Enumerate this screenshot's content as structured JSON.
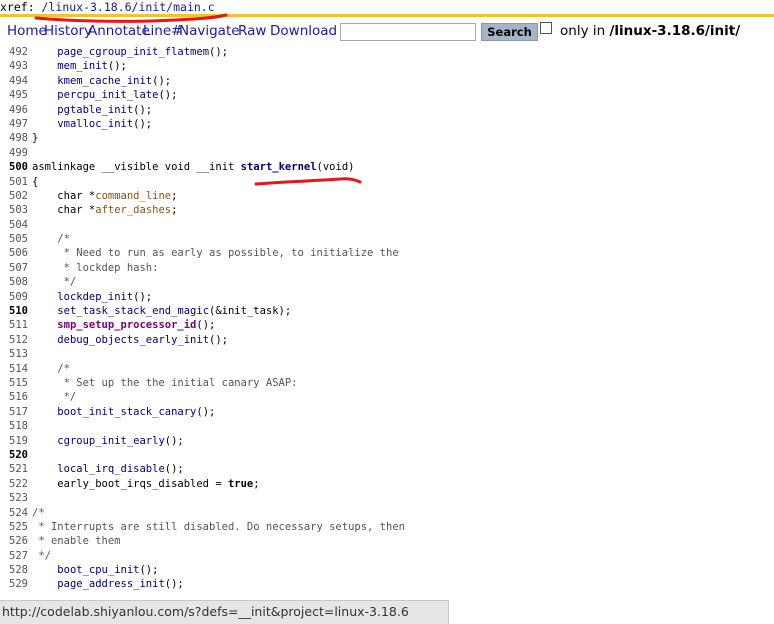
{
  "xref": {
    "prefix": "xref: ",
    "path": "/linux-3.18.6/init/main.c"
  },
  "nav": {
    "links": [
      "Home",
      "History",
      "Annotate",
      "Line#",
      "Navigate",
      "Raw",
      "Download"
    ],
    "search_button": "Search",
    "only_in_prefix": "only in ",
    "only_in_path": "/linux-3.18.6/init/"
  },
  "code_lines": [
    {
      "num": "492",
      "text": "    page_cgroup_init_flatmem();"
    },
    {
      "num": "493",
      "text": "    mem_init();"
    },
    {
      "num": "494",
      "text": "    kmem_cache_init();"
    },
    {
      "num": "495",
      "text": "    percpu_init_late();"
    },
    {
      "num": "496",
      "text": "    pgtable_init();"
    },
    {
      "num": "497",
      "text": "    vmalloc_init();"
    },
    {
      "num": "498",
      "text": "}"
    },
    {
      "num": "499",
      "text": ""
    },
    {
      "num": "500",
      "text": "asmlinkage __visible void __init start_kernel(void)"
    },
    {
      "num": "501",
      "text": "{"
    },
    {
      "num": "502",
      "text": "    char *command_line;"
    },
    {
      "num": "503",
      "text": "    char *after_dashes;"
    },
    {
      "num": "504",
      "text": ""
    },
    {
      "num": "505",
      "text": "    /*"
    },
    {
      "num": "506",
      "text": "     * Need to run as early as possible, to initialize the"
    },
    {
      "num": "507",
      "text": "     * lockdep hash:"
    },
    {
      "num": "508",
      "text": "     */"
    },
    {
      "num": "509",
      "text": "    lockdep_init();"
    },
    {
      "num": "510",
      "text": "    set_task_stack_end_magic(&init_task);"
    },
    {
      "num": "511",
      "text": "    smp_setup_processor_id();"
    },
    {
      "num": "512",
      "text": "    debug_objects_early_init();"
    },
    {
      "num": "513",
      "text": ""
    },
    {
      "num": "514",
      "text": "    /*"
    },
    {
      "num": "515",
      "text": "     * Set up the the initial canary ASAP:"
    },
    {
      "num": "516",
      "text": "     */"
    },
    {
      "num": "517",
      "text": "    boot_init_stack_canary();"
    },
    {
      "num": "518",
      "text": ""
    },
    {
      "num": "519",
      "text": "    cgroup_init_early();"
    },
    {
      "num": "520",
      "text": ""
    },
    {
      "num": "521",
      "text": "    local_irq_disable();"
    },
    {
      "num": "522",
      "text": "    early_boot_irqs_disabled = true;"
    },
    {
      "num": "523",
      "text": ""
    },
    {
      "num": "524",
      "text": "/*"
    },
    {
      "num": "525",
      "text": " * Interrupts are still disabled. Do necessary setups, then"
    },
    {
      "num": "526",
      "text": " * enable them"
    },
    {
      "num": "527",
      "text": " */"
    },
    {
      "num": "528",
      "text": "    boot_cpu_init();"
    },
    {
      "num": "529",
      "text": "    page_address_init();"
    }
  ],
  "status_url": "http://codelab.shiyanlou.com/s?defs=__init&project=linux-3.18.6",
  "colors": {
    "accent_rule": "#f2c230",
    "link": "#1a1aa6",
    "annotation": "#e8151b"
  }
}
